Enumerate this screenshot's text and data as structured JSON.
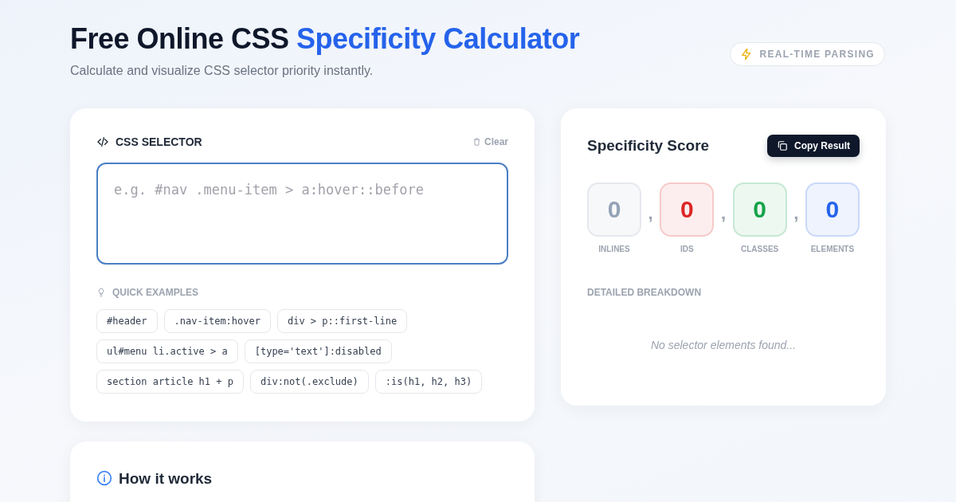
{
  "header": {
    "title_lead": "Free Online CSS",
    "title_highlight": "Specificity Calculator",
    "subtitle": "Calculate and visualize CSS selector priority instantly.",
    "badge": "REAL-TIME PARSING"
  },
  "selector_card": {
    "label": "CSS SELECTOR",
    "clear": "Clear",
    "placeholder": "e.g. #nav .menu-item > a:hover::before",
    "examples_label": "QUICK EXAMPLES",
    "examples": [
      [
        "#header",
        ".nav-item:hover",
        "div > p::first-line"
      ],
      [
        "ul#menu li.active > a",
        "[type='text']:disabled"
      ],
      [
        "section article h1 + p",
        "div:not(.exclude)",
        ":is(h1, h2, h3)"
      ]
    ]
  },
  "score_card": {
    "title": "Specificity Score",
    "copy_button": "Copy Result",
    "separator": ",",
    "scores": [
      {
        "value": "0",
        "label": "INLINES",
        "color": "#94a3b8"
      },
      {
        "value": "0",
        "label": "IDS",
        "color": "#dc2626"
      },
      {
        "value": "0",
        "label": "CLASSES",
        "color": "#16a34a"
      },
      {
        "value": "0",
        "label": "ELEMENTS",
        "color": "#2563eb"
      }
    ],
    "breakdown_label": "DETAILED BREAKDOWN",
    "empty_message": "No selector elements found..."
  },
  "info_card": {
    "title": "How it works"
  }
}
